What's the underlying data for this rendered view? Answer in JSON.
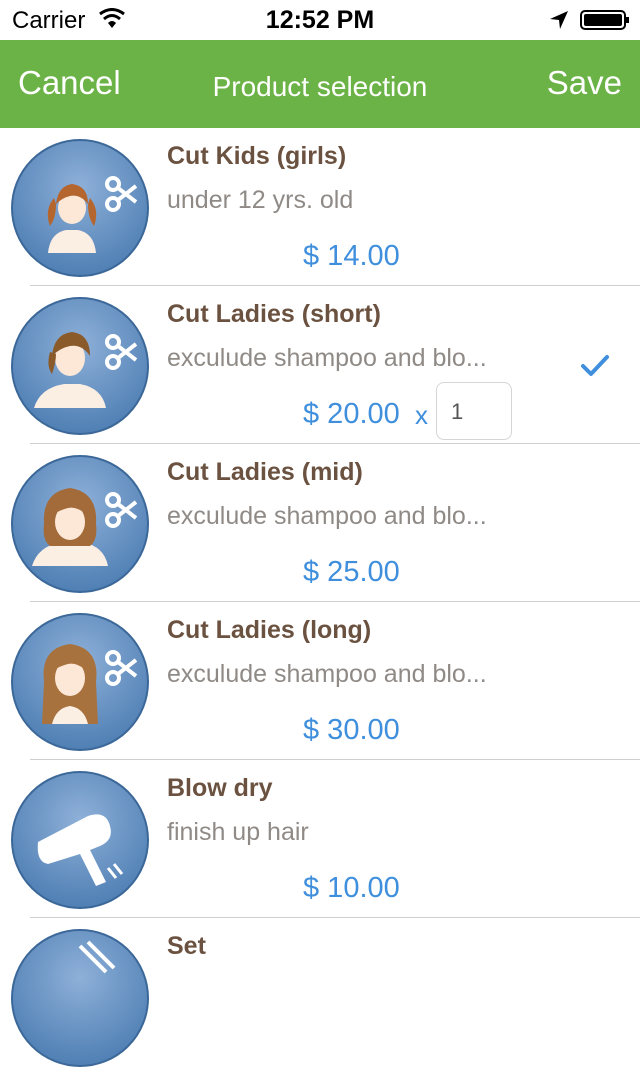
{
  "status_bar": {
    "carrier": "Carrier",
    "time": "12:52 PM"
  },
  "nav": {
    "cancel_label": "Cancel",
    "title": "Product selection",
    "save_label": "Save"
  },
  "products": [
    {
      "name": "Cut Kids (girls)",
      "description": "under 12 yrs. old",
      "price": "$ 14.00",
      "icon": "girl-kid-haircut-icon"
    },
    {
      "name": "Cut Ladies (short)",
      "description": "exculude shampoo and blo...",
      "price": "$ 20.00",
      "selected": true,
      "quantity_prefix": "x",
      "quantity": "1",
      "icon": "short-hair-haircut-icon"
    },
    {
      "name": "Cut Ladies (mid)",
      "description": "exculude shampoo and blo...",
      "price": "$ 25.00",
      "icon": "mid-hair-haircut-icon"
    },
    {
      "name": "Cut Ladies (long)",
      "description": "exculude shampoo and blo...",
      "price": "$ 30.00",
      "icon": "long-hair-haircut-icon"
    },
    {
      "name": "Blow dry",
      "description": "finish up hair",
      "price": "$ 10.00",
      "icon": "hair-dryer-icon"
    },
    {
      "name": "Set",
      "description": "",
      "price": "",
      "icon": "set-icon"
    }
  ],
  "colors": {
    "nav_bg": "#6cb347",
    "price": "#3f8fdd",
    "name": "#6b5240",
    "desc": "#8f8a86",
    "avatar": "#5f8ec0"
  }
}
